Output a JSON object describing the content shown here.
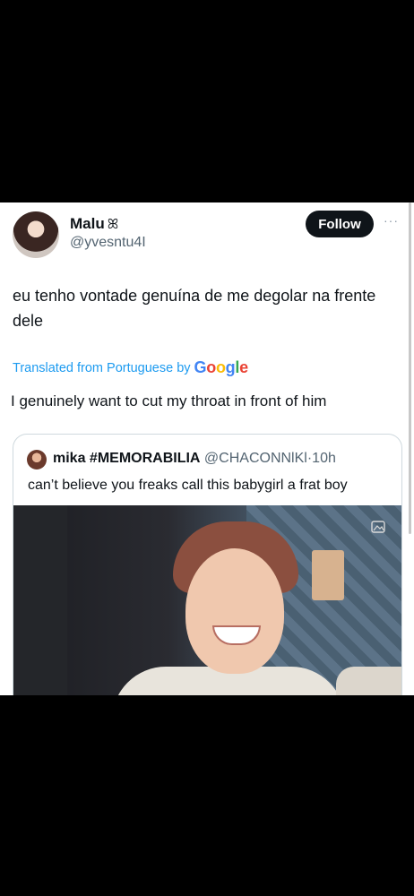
{
  "author": {
    "name": "Malu",
    "badge": "ꕤ",
    "handle": "@yvesntu4I",
    "follow_label": "Follow",
    "more_label": "···"
  },
  "post": {
    "original_text": "eu tenho vontade genuína de me degolar na frente dele",
    "translated_from": "Translated from Portuguese by",
    "translator_logo": [
      "G",
      "o",
      "o",
      "g",
      "l",
      "e"
    ],
    "translation": "I genuinely want to cut my throat in front of him"
  },
  "quoted": {
    "name": "mika #MEMORABILIA",
    "handle": "@CHACONNlKl",
    "time": "10h",
    "separator": "·",
    "text": "can’t believe you freaks call this babygirl a frat boy",
    "alt_icon": "image-alt-icon"
  },
  "colors": {
    "accent": "#1d9bf0",
    "text": "#0f1419",
    "secondary": "#536471",
    "follow_bg": "#0f1419"
  }
}
